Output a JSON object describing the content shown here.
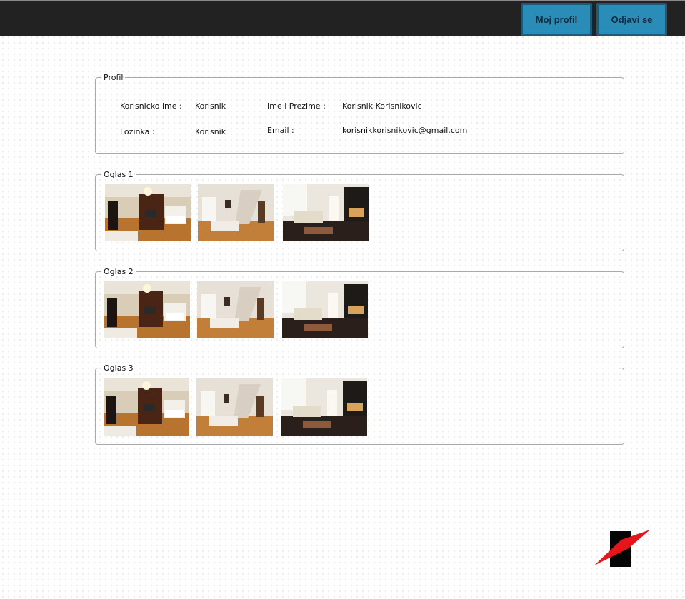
{
  "header": {
    "profile_button": "Moj profil",
    "logout_button": "Odjavi se"
  },
  "profile": {
    "legend": "Profil",
    "username_label": "Korisnicko ime :",
    "username_value": "Korisnik",
    "password_label": "Lozinka :",
    "password_value": "Korisnik",
    "fullname_label": "Ime i Prezime :",
    "fullname_value": "Korisnik Korisnikovic",
    "email_label": "Email :",
    "email_value": "korisnikkorisnikovic@gmail.com"
  },
  "ads": [
    {
      "legend": "Oglas 1"
    },
    {
      "legend": "Oglas 2"
    },
    {
      "legend": "Oglas 3"
    }
  ],
  "colors": {
    "topbar": "#222222",
    "button": "#2a8db8",
    "logo_red": "#e8141c"
  }
}
